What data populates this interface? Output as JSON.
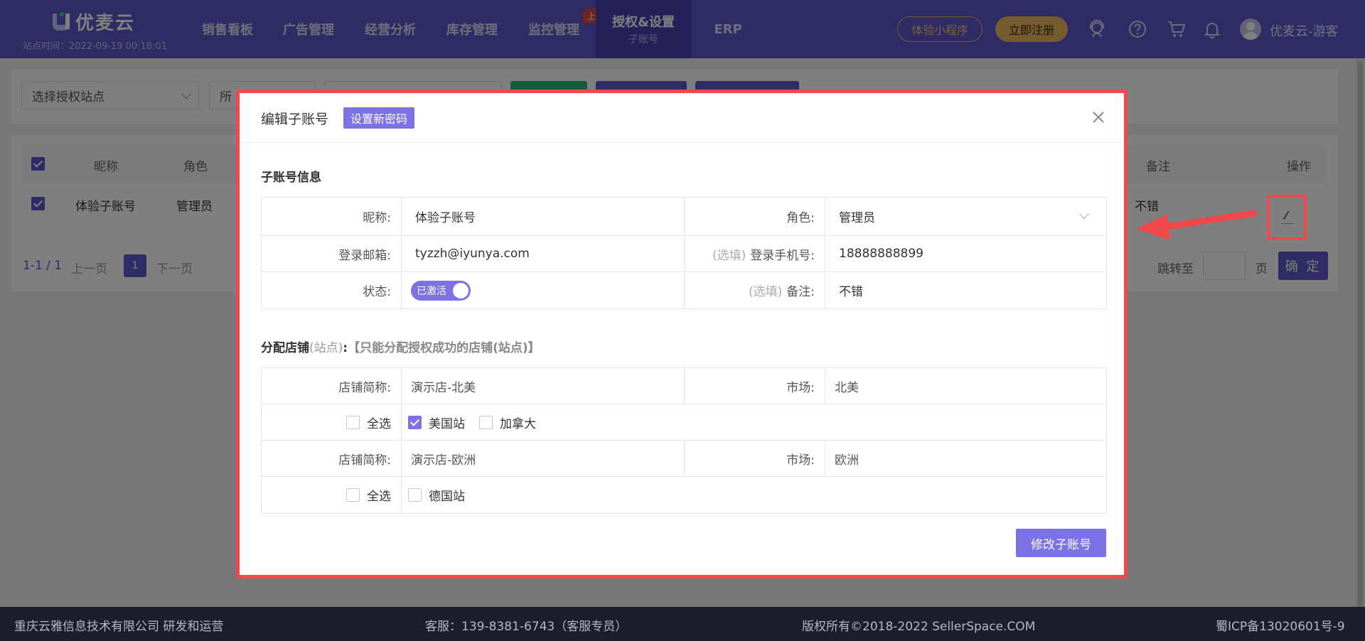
{
  "brand": {
    "name": "优麦云",
    "site_time": "站点时间：2022-09-19 00:18:01"
  },
  "nav": {
    "items": [
      {
        "label": "销售看板"
      },
      {
        "label": "广告管理"
      },
      {
        "label": "经营分析"
      },
      {
        "label": "库存管理"
      },
      {
        "label": "监控管理"
      },
      {
        "label": "授权&设置",
        "sub": "子账号"
      },
      {
        "label": "ERP"
      }
    ],
    "new_badge": "上新",
    "mini_program": "体验小程序",
    "register": "立即注册",
    "user": "优麦云-游客"
  },
  "filter": {
    "site_select": "选择授权站点",
    "second_select": "所"
  },
  "table": {
    "headers": [
      "昵称",
      "角色",
      "备注",
      "操作"
    ],
    "row": {
      "nickname": "体验子账号",
      "role": "管理员",
      "remark": "不错"
    },
    "pager": {
      "range": "1-1 / 1",
      "prev": "上一页",
      "page": "1",
      "next": "下一页",
      "jump": "跳转至",
      "page_unit": "页",
      "confirm": "确 定"
    }
  },
  "modal": {
    "title": "编辑子账号",
    "set_password": "设置新密码",
    "section1": "子账号信息",
    "fields": {
      "nickname_label": "昵称:",
      "nickname_value": "体验子账号",
      "role_label": "角色:",
      "role_value": "管理员",
      "email_label": "登录邮箱:",
      "email_value": "tyzzh@iyunya.com",
      "phone_optional": "(选填)",
      "phone_label": "登录手机号:",
      "phone_value": "18888888899",
      "status_label": "状态:",
      "status_value": "已激活",
      "remark_optional": "(选填)",
      "remark_label": "备注:",
      "remark_value": "不错"
    },
    "section2": {
      "prefix": "分配店铺",
      "site": "(站点)",
      "colon": ":",
      "note": "【只能分配授权成功的店铺(站点)】"
    },
    "stores": [
      {
        "name_label": "店铺简称:",
        "name": "演示店-北美",
        "market_label": "市场:",
        "market": "北美",
        "select_all": "全选",
        "sites": [
          {
            "label": "美国站",
            "checked": true
          },
          {
            "label": "加拿大",
            "checked": false
          }
        ]
      },
      {
        "name_label": "店铺简称:",
        "name": "演示店-欧洲",
        "market_label": "市场:",
        "market": "欧洲",
        "select_all": "全选",
        "sites": [
          {
            "label": "德国站",
            "checked": false
          }
        ]
      }
    ],
    "submit": "修改子账号"
  },
  "footer": {
    "company": "重庆云雅信息技术有限公司 研发和运营",
    "service": "客服：139-8381-6743（客服专员）",
    "copyright": "版权所有©2018-2022 SellerSpace.COM",
    "icp": "蜀ICP备13020601号-9"
  },
  "colors": {
    "primary": "#5f57c9",
    "accent": "#7b72e6",
    "highlight": "#f0484b",
    "gold": "#e8b85c"
  }
}
